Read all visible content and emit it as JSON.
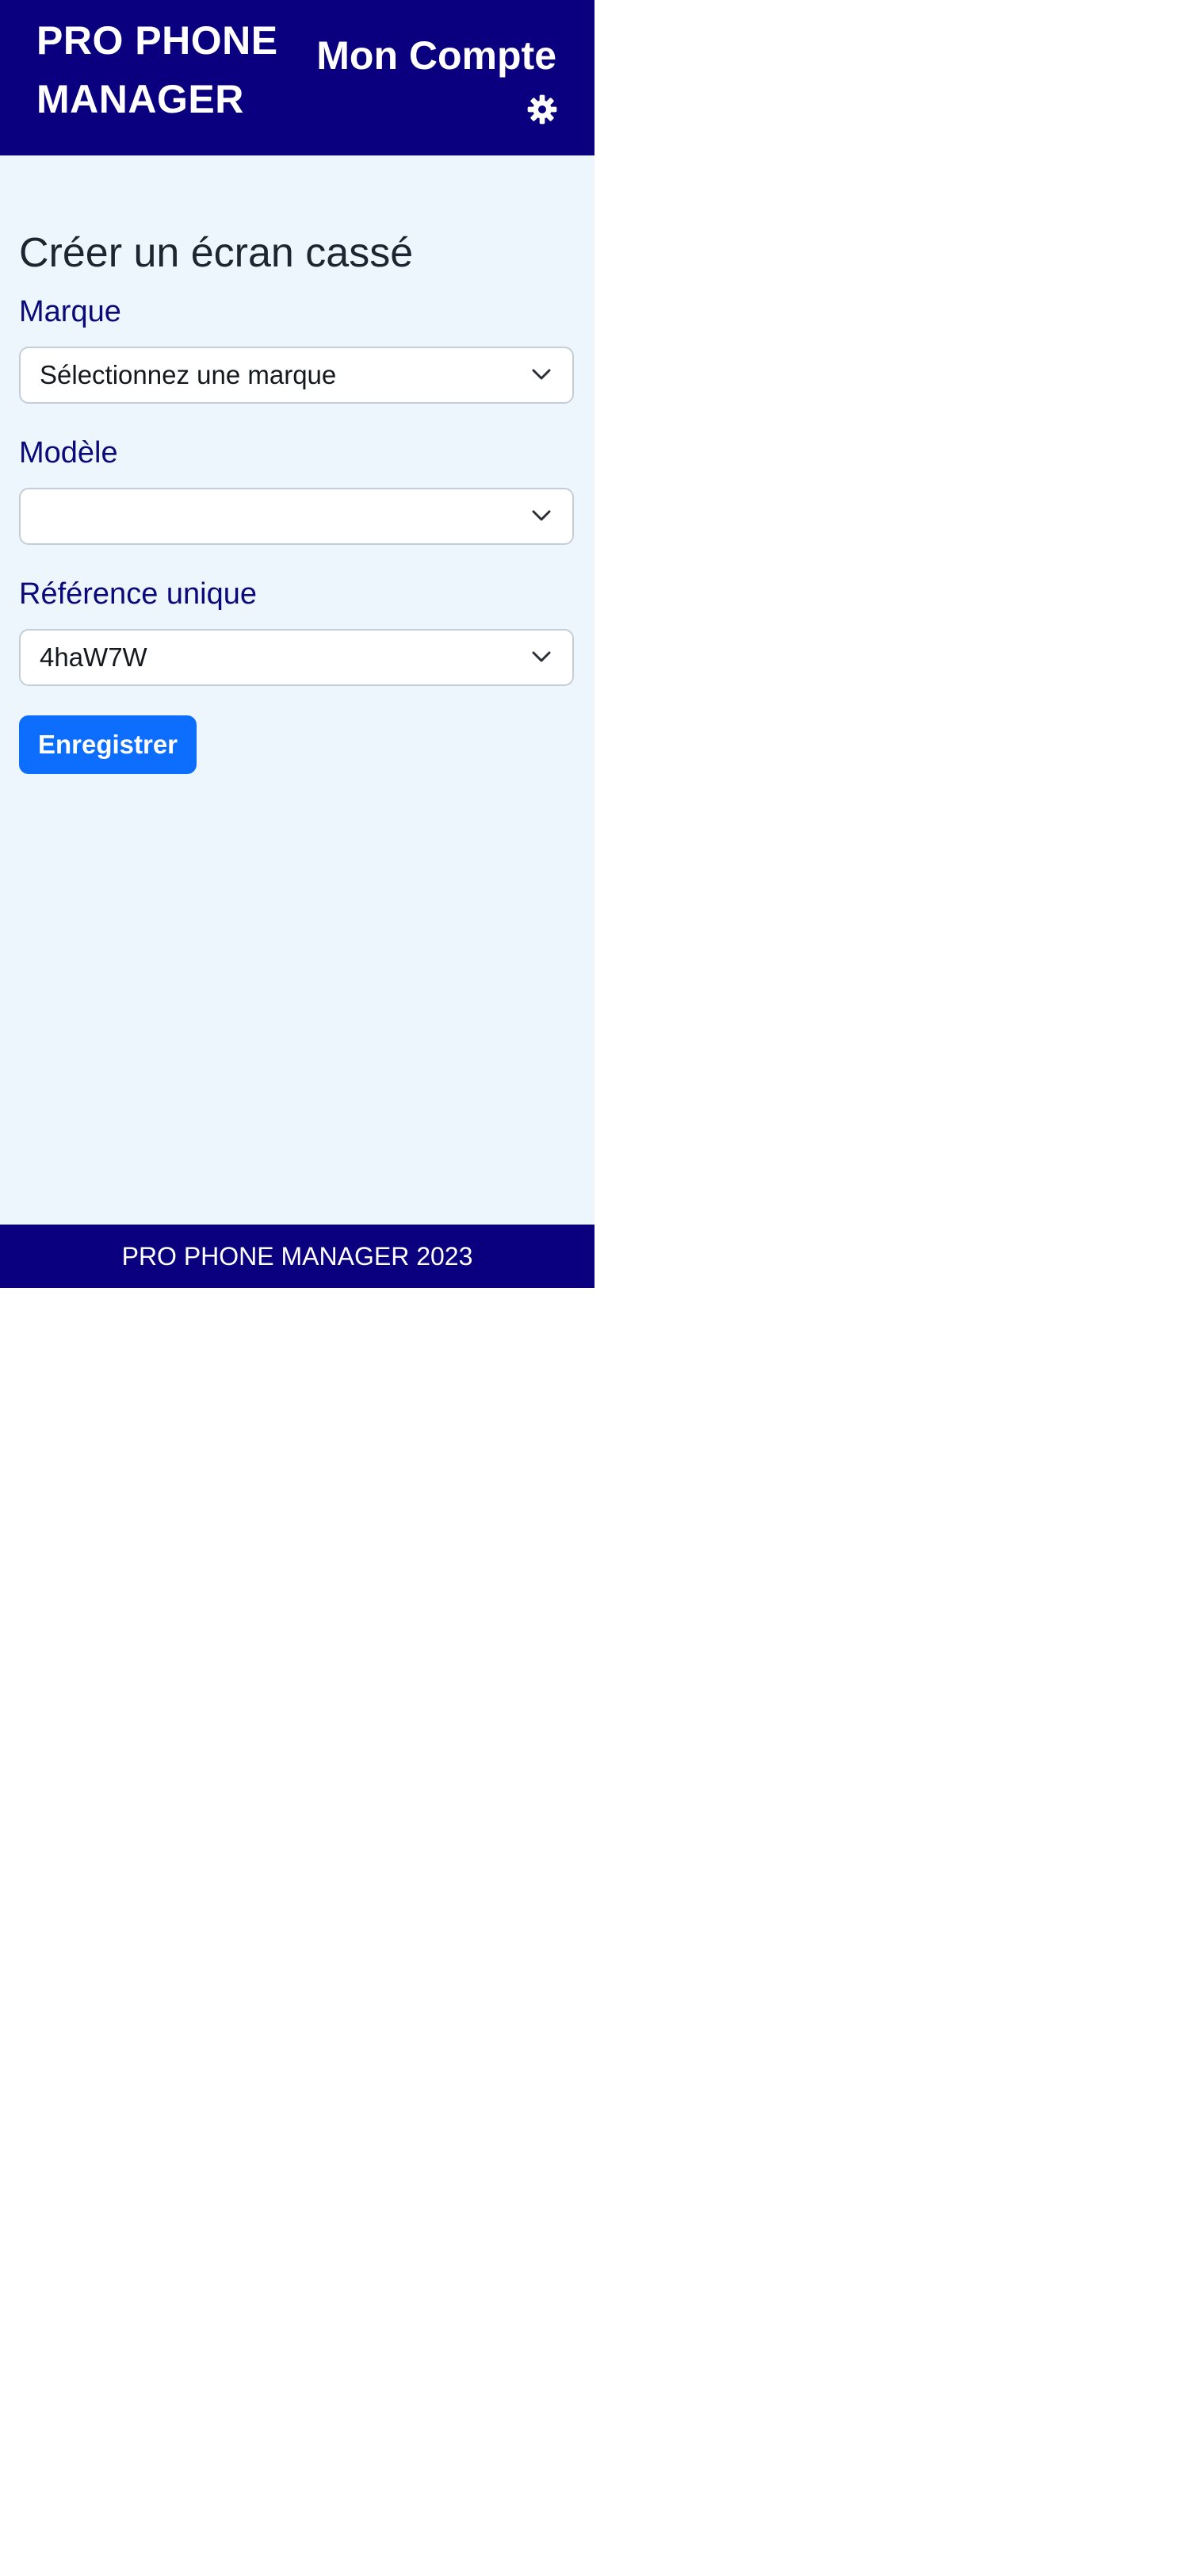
{
  "header": {
    "brand": "PRO PHONE MANAGER",
    "account_label": "Mon Compte",
    "settings_icon": "gear-icon"
  },
  "main": {
    "title": "Créer un écran cassé",
    "fields": {
      "marque": {
        "label": "Marque",
        "value": "Sélectionnez une marque"
      },
      "modele": {
        "label": "Modèle",
        "value": ""
      },
      "reference": {
        "label": "Référence unique",
        "value": "4haW7W"
      }
    },
    "save_label": "Enregistrer"
  },
  "footer": {
    "text": "PRO PHONE MANAGER 2023"
  },
  "colors": {
    "header_bg": "#0a007f",
    "page_bg": "#eef6fd",
    "label_color": "#0a0a7a",
    "button_bg": "#0d6efd"
  }
}
